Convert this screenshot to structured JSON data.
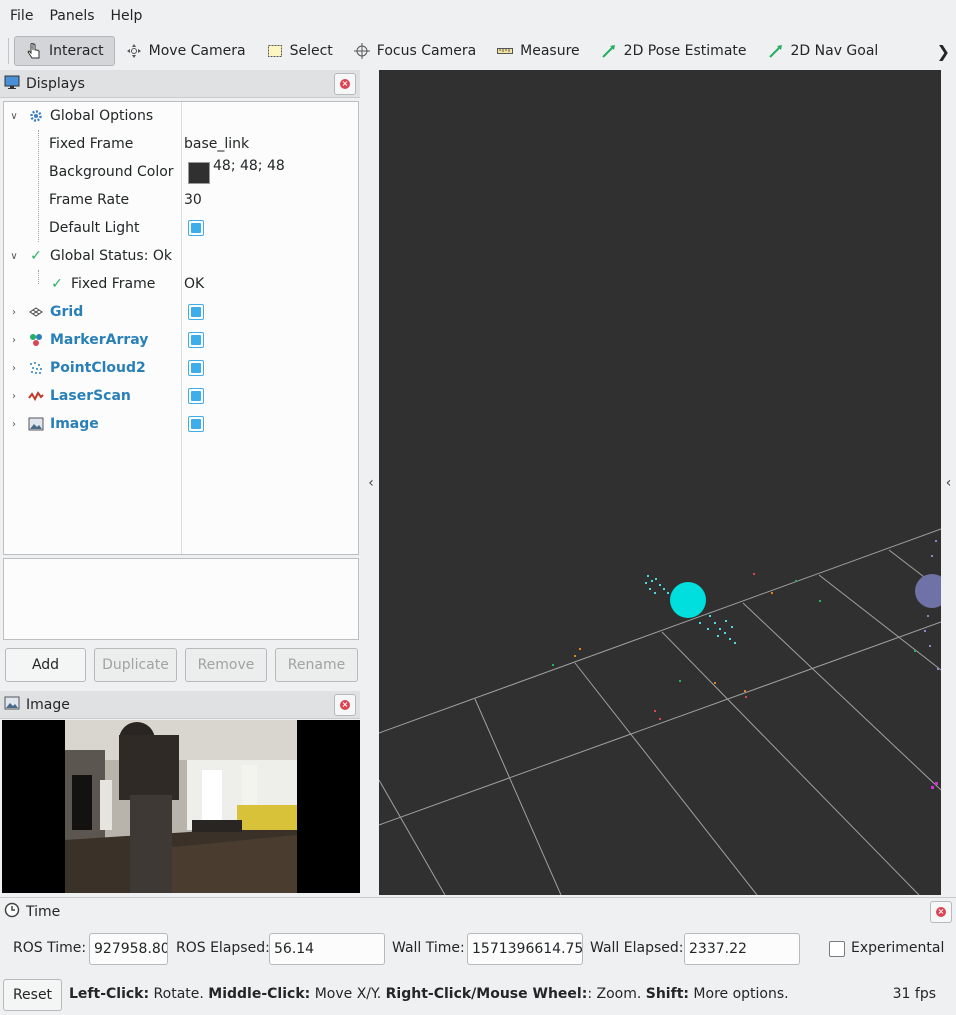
{
  "menu": [
    "File",
    "Panels",
    "Help"
  ],
  "toolbar": {
    "tools": [
      {
        "label": "Interact",
        "icon": "hand-pointer-icon",
        "active": true
      },
      {
        "label": "Move Camera",
        "icon": "move-camera-icon"
      },
      {
        "label": "Select",
        "icon": "select-box-icon"
      },
      {
        "label": "Focus Camera",
        "icon": "focus-crosshair-icon"
      },
      {
        "label": "Measure",
        "icon": "ruler-icon"
      },
      {
        "label": "2D Pose Estimate",
        "icon": "green-arrow-icon"
      },
      {
        "label": "2D Nav Goal",
        "icon": "green-arrow-icon"
      }
    ],
    "more_icon": "chevron-right-icon"
  },
  "displays_panel": {
    "title": "Displays",
    "tree": {
      "global_options": {
        "label": "Global Options"
      },
      "fixed_frame": {
        "label": "Fixed Frame",
        "value": "base_link"
      },
      "background_color": {
        "label": "Background Color",
        "value": "48; 48; 48",
        "swatch": "#303030"
      },
      "frame_rate": {
        "label": "Frame Rate",
        "value": "30"
      },
      "default_light": {
        "label": "Default Light",
        "checked": true
      },
      "global_status": {
        "label": "Global Status: Ok"
      },
      "status_fixed_frame": {
        "label": "Fixed Frame",
        "value": "OK"
      },
      "grid": {
        "label": "Grid",
        "checked": true
      },
      "marker_array": {
        "label": "MarkerArray",
        "checked": true
      },
      "pointcloud2": {
        "label": "PointCloud2",
        "checked": true
      },
      "laserscan": {
        "label": "LaserScan",
        "checked": true
      },
      "image": {
        "label": "Image",
        "checked": true
      }
    },
    "buttons": {
      "add": "Add",
      "duplicate": "Duplicate",
      "remove": "Remove",
      "rename": "Rename"
    }
  },
  "image_panel": {
    "title": "Image"
  },
  "time_panel": {
    "title": "Time",
    "ros_time_label": "ROS Time:",
    "ros_time": "927958.80",
    "ros_elapsed_label": "ROS Elapsed:",
    "ros_elapsed": "56.14",
    "wall_time_label": "Wall Time:",
    "wall_time": "1571396614.75",
    "wall_elapsed_label": "Wall Elapsed:",
    "wall_elapsed": "2337.22",
    "experimental_label": "Experimental"
  },
  "statusbar": {
    "reset": "Reset",
    "left_click": "Left-Click:",
    "rotate": " Rotate. ",
    "middle_click": "Middle-Click:",
    "move_xy": " Move X/Y. ",
    "right_click": "Right-Click/Mouse Wheel:",
    "zoom": ": Zoom. ",
    "shift": "Shift:",
    "more": " More options.",
    "fps": "31 fps"
  },
  "colors": {
    "accent": "#3daee9",
    "link_blue": "#2980b9",
    "viewport_bg": "#303030",
    "marker": "#00dede"
  }
}
